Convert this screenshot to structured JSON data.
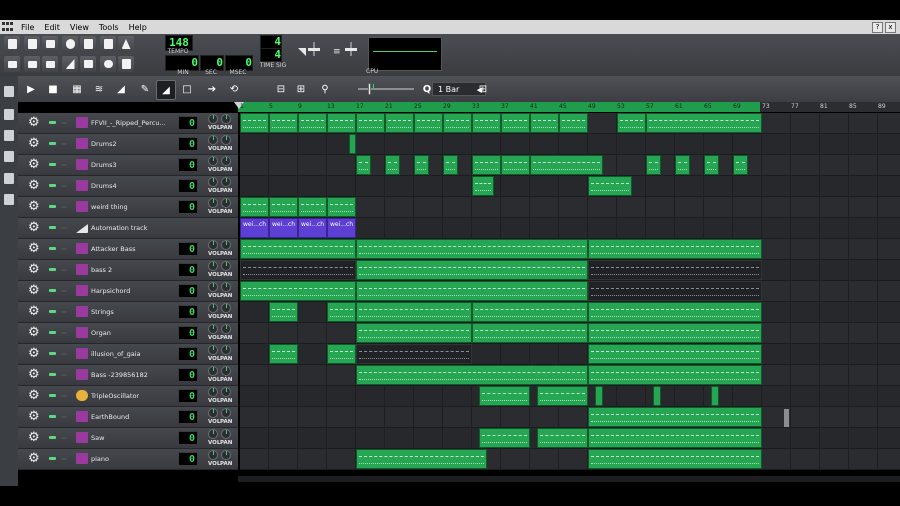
{
  "menu": [
    "File",
    "Edit",
    "View",
    "Tools",
    "Help"
  ],
  "window_buttons": [
    "?",
    "x"
  ],
  "transport": {
    "tempo": "148",
    "tempo_label": "TEMPO",
    "min": "0",
    "min_label": "MIN",
    "sec": "0",
    "sec_label": "SEC",
    "msec": "0",
    "msec_label": "MSEC",
    "timesig_top": "4",
    "timesig_bottom": "4",
    "timesig_label": "TIME SIG",
    "cpu_label": "CPU"
  },
  "song_toolbar": {
    "snap_value": "1 Bar",
    "buttons": [
      "play",
      "stop",
      "add-pattern",
      "add-sample",
      "add-automation",
      "draw",
      "erase",
      "select",
      "follow",
      "loop",
      "record",
      "record-accompany",
      "zoom",
      "snap"
    ]
  },
  "ruler_ticks": [
    "1",
    "5",
    "9",
    "13",
    "17",
    "21",
    "25",
    "29",
    "33",
    "37",
    "41",
    "45",
    "49",
    "53",
    "57",
    "61",
    "65",
    "69",
    "73",
    "77",
    "81",
    "85",
    "89"
  ],
  "ruler_played_to": "69",
  "tracks": [
    {
      "name": "FFVII_-_Ripped_Percu...",
      "type": "instrument",
      "lcd": "0"
    },
    {
      "name": "Drums2",
      "type": "instrument",
      "lcd": "0"
    },
    {
      "name": "Drums3",
      "type": "instrument",
      "lcd": "0"
    },
    {
      "name": "Drums4",
      "type": "instrument",
      "lcd": "0"
    },
    {
      "name": "weird thing",
      "type": "instrument",
      "lcd": "0"
    },
    {
      "name": "Automation track",
      "type": "automation",
      "lcd": ""
    },
    {
      "name": "Attacker Bass",
      "type": "instrument",
      "lcd": "0"
    },
    {
      "name": "bass 2",
      "type": "instrument",
      "lcd": "0"
    },
    {
      "name": "Harpsichord",
      "type": "instrument",
      "lcd": "0"
    },
    {
      "name": "Strings",
      "type": "instrument",
      "lcd": "0"
    },
    {
      "name": "Organ",
      "type": "instrument",
      "lcd": "0"
    },
    {
      "name": "illusion_of_gaia",
      "type": "instrument",
      "lcd": "0"
    },
    {
      "name": "Bass -239856182",
      "type": "instrument",
      "lcd": "0"
    },
    {
      "name": "TripleOscillator",
      "type": "osc",
      "lcd": "0"
    },
    {
      "name": "EarthBound",
      "type": "instrument",
      "lcd": "0"
    },
    {
      "name": "Saw",
      "type": "instrument",
      "lcd": "0"
    },
    {
      "name": "piano",
      "type": "instrument",
      "lcd": "0"
    }
  ],
  "knob_labels": {
    "vol": "VOL",
    "pan": "PAN"
  },
  "automation_clip_label": "wei...ch",
  "clips": [
    [
      [
        1,
        5
      ],
      [
        5,
        9
      ],
      [
        9,
        13
      ],
      [
        13,
        17
      ],
      [
        17,
        21
      ],
      [
        21,
        25
      ],
      [
        25,
        29
      ],
      [
        29,
        33
      ],
      [
        33,
        37
      ],
      [
        37,
        41
      ],
      [
        41,
        45
      ],
      [
        45,
        49
      ],
      [
        53,
        57
      ],
      [
        57,
        73
      ]
    ],
    [
      [
        16,
        17
      ]
    ],
    [
      [
        17,
        19
      ],
      [
        21,
        23
      ],
      [
        25,
        27
      ],
      [
        29,
        31
      ],
      [
        33,
        37
      ],
      [
        37,
        41
      ],
      [
        41,
        51
      ],
      [
        57,
        59
      ],
      [
        61,
        63
      ],
      [
        65,
        67
      ],
      [
        69,
        71
      ]
    ],
    [
      [
        33,
        36
      ],
      [
        49,
        55
      ]
    ],
    [
      [
        1,
        5
      ],
      [
        5,
        9
      ],
      [
        9,
        13
      ],
      [
        13,
        17
      ]
    ],
    [
      [
        1,
        5
      ],
      [
        5,
        9
      ],
      [
        9,
        13
      ],
      [
        13,
        17
      ]
    ],
    [
      [
        1,
        17
      ],
      [
        17,
        49
      ],
      [
        49,
        73
      ]
    ],
    [
      [
        1,
        17
      ],
      [
        17,
        49
      ],
      [
        49,
        73
      ]
    ],
    [
      [
        1,
        17
      ],
      [
        17,
        49
      ],
      [
        49,
        73
      ]
    ],
    [
      [
        5,
        9
      ],
      [
        13,
        17
      ],
      [
        17,
        33
      ],
      [
        33,
        49
      ],
      [
        49,
        73
      ]
    ],
    [
      [
        17,
        33
      ],
      [
        33,
        49
      ],
      [
        49,
        73
      ]
    ],
    [
      [
        5,
        9
      ],
      [
        13,
        17
      ],
      [
        17,
        33
      ],
      [
        49,
        73
      ]
    ],
    [
      [
        17,
        49
      ],
      [
        49,
        73
      ]
    ],
    [
      [
        34,
        41
      ],
      [
        42,
        49
      ],
      [
        50,
        51
      ],
      [
        58,
        59
      ],
      [
        66,
        67
      ]
    ],
    [
      [
        49,
        73
      ]
    ],
    [
      [
        34,
        41
      ],
      [
        42,
        49
      ],
      [
        49,
        73
      ]
    ],
    [
      [
        17,
        35
      ],
      [
        49,
        73
      ]
    ]
  ],
  "dark_clips": {
    "7": [
      [
        1,
        17
      ],
      [
        49,
        73
      ]
    ],
    "8": [
      [
        49,
        73
      ]
    ],
    "11": [
      [
        17,
        33
      ]
    ]
  }
}
